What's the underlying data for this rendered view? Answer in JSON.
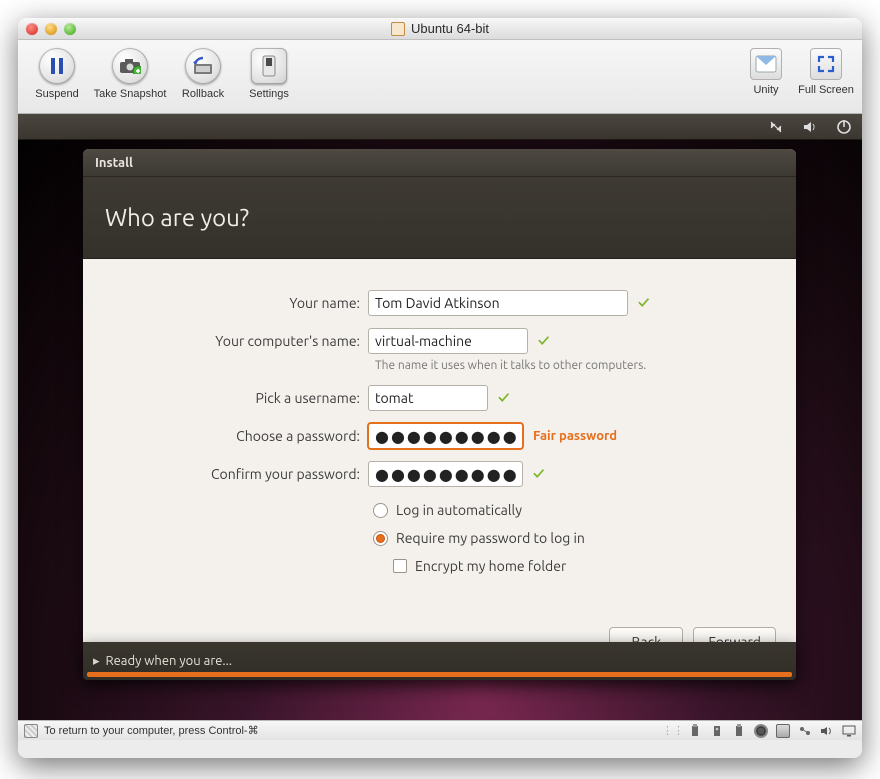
{
  "window": {
    "title": "Ubuntu 64-bit"
  },
  "toolbar": {
    "suspend": "Suspend",
    "snapshot": "Take Snapshot",
    "rollback": "Rollback",
    "settings": "Settings",
    "unity": "Unity",
    "fullscreen": "Full Screen"
  },
  "installer": {
    "window_title": "Install",
    "heading": "Who are you?",
    "labels": {
      "name": "Your name:",
      "computer": "Your computer's name:",
      "computer_help": "The name it uses when it talks to other computers.",
      "username": "Pick a username:",
      "password": "Choose a password:",
      "confirm": "Confirm your password:"
    },
    "values": {
      "name": "Tom David Atkinson",
      "computer": "virtual-machine",
      "username": "tomat",
      "password": "●●●●●●●●●●",
      "confirm": "●●●●●●●●●●"
    },
    "password_strength": "Fair password",
    "options": {
      "auto_login": "Log in automatically",
      "require_password": "Require my password to log in",
      "encrypt": "Encrypt my home folder",
      "selected": "require_password"
    },
    "buttons": {
      "back": "Back",
      "forward": "Forward"
    }
  },
  "ready_bar": "Ready when you are...",
  "statusbar": {
    "hint": "To return to your computer, press Control-⌘"
  }
}
